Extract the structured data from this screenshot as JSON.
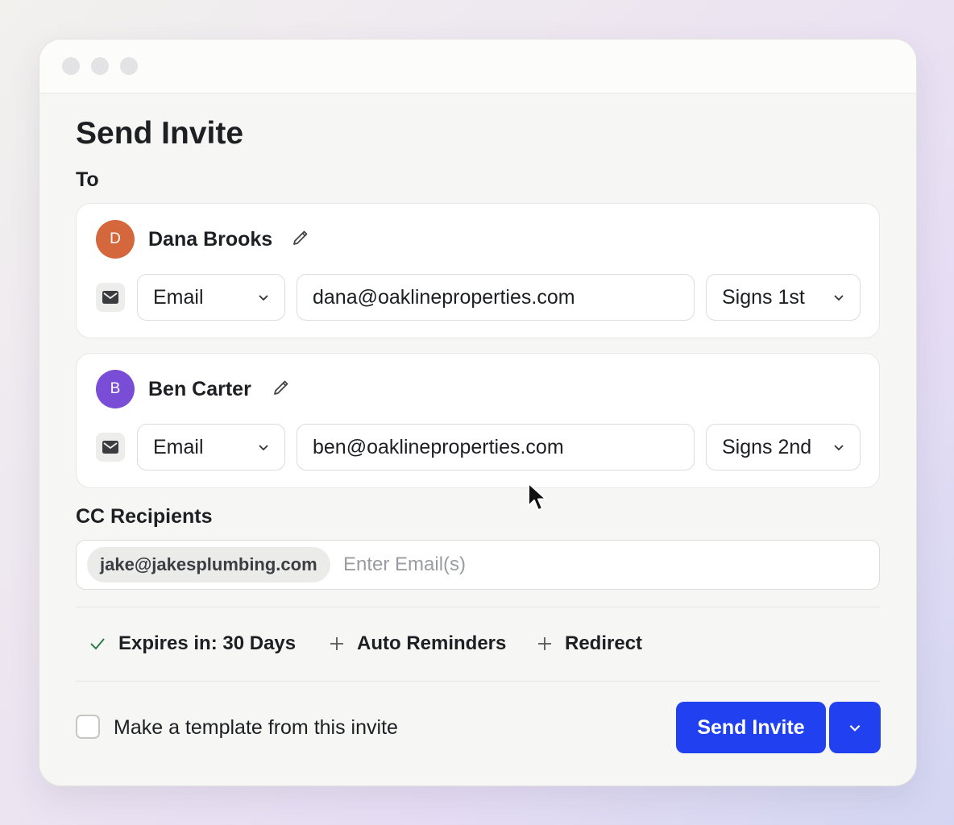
{
  "window": {
    "title": "Send Invite",
    "to_label": "To"
  },
  "recipients": [
    {
      "initial": "D",
      "name": "Dana Brooks",
      "avatar_color": "#d4673b",
      "method": "Email",
      "email": "dana@oaklineproperties.com",
      "order": "Signs 1st"
    },
    {
      "initial": "B",
      "name": "Ben Carter",
      "avatar_color": "#7a4dd6",
      "method": "Email",
      "email": "ben@oaklineproperties.com",
      "order": "Signs 2nd"
    }
  ],
  "cc": {
    "label": "CC Recipients",
    "chips": [
      "jake@jakesplumbing.com"
    ],
    "placeholder": "Enter Email(s)"
  },
  "options": {
    "expires": "Expires in: 30 Days",
    "reminders": "Auto Reminders",
    "redirect": "Redirect"
  },
  "footer": {
    "template_label": "Make a template from this invite",
    "template_checked": false,
    "send_label": "Send Invite"
  },
  "colors": {
    "primary": "#2141f1",
    "check": "#2e7d4f"
  },
  "icons": {
    "edit": "pencil-icon",
    "mail": "envelope-icon",
    "dropdown": "chevron-down-icon",
    "enabled": "check-icon",
    "add": "plus-icon"
  }
}
